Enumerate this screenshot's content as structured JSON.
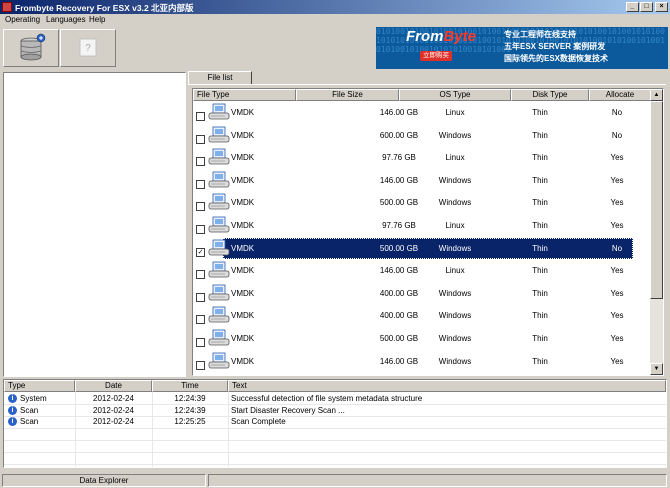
{
  "window": {
    "title": "Frombyte Recovery For ESX v3.2 北亚内部版"
  },
  "window_buttons": {
    "minimize": "_",
    "maximize": "□",
    "close": "×"
  },
  "menu": [
    {
      "label": "Operating"
    },
    {
      "label": "Languages"
    },
    {
      "label": "Help"
    }
  ],
  "toolbar": {
    "help_glyph": "?"
  },
  "banner": {
    "brand_from": "From",
    "brand_byte": "Byte",
    "badge": "立即购买",
    "line1": "专业工程师在线支持",
    "line2": "五年ESX SERVER 案例研发",
    "line3": "国际领先的ESX数据恢复技术",
    "binary": "0101001010010100101001010011010100101001010101001010010101001010101010010010100101001010101001010010101010010101001010010101001010010101010010101001"
  },
  "tabs": [
    {
      "label": "File list"
    }
  ],
  "file_grid": {
    "columns": [
      "File Type",
      "File Size",
      "OS Type",
      "Disk Type",
      "Allocate"
    ],
    "rows": [
      {
        "type": "VMDK",
        "size": "146.00 GB",
        "os": "Linux",
        "disk": "Thin",
        "alloc": "No",
        "checked": false,
        "selected": false
      },
      {
        "type": "VMDK",
        "size": "600.00 GB",
        "os": "Windows",
        "disk": "Thin",
        "alloc": "No",
        "checked": false,
        "selected": false
      },
      {
        "type": "VMDK",
        "size": "97.76 GB",
        "os": "Linux",
        "disk": "Thin",
        "alloc": "Yes",
        "checked": false,
        "selected": false
      },
      {
        "type": "VMDK",
        "size": "146.00 GB",
        "os": "Windows",
        "disk": "Thin",
        "alloc": "Yes",
        "checked": false,
        "selected": false
      },
      {
        "type": "VMDK",
        "size": "500.00 GB",
        "os": "Windows",
        "disk": "Thin",
        "alloc": "Yes",
        "checked": false,
        "selected": false
      },
      {
        "type": "VMDK",
        "size": "97.76 GB",
        "os": "Linux",
        "disk": "Thin",
        "alloc": "Yes",
        "checked": false,
        "selected": false
      },
      {
        "type": "VMDK",
        "size": "500.00 GB",
        "os": "Windows",
        "disk": "Thin",
        "alloc": "No",
        "checked": true,
        "selected": true
      },
      {
        "type": "VMDK",
        "size": "146.00 GB",
        "os": "Linux",
        "disk": "Thin",
        "alloc": "Yes",
        "checked": false,
        "selected": false
      },
      {
        "type": "VMDK",
        "size": "400.00 GB",
        "os": "Windows",
        "disk": "Thin",
        "alloc": "Yes",
        "checked": false,
        "selected": false
      },
      {
        "type": "VMDK",
        "size": "400.00 GB",
        "os": "Windows",
        "disk": "Thin",
        "alloc": "Yes",
        "checked": false,
        "selected": false
      },
      {
        "type": "VMDK",
        "size": "500.00 GB",
        "os": "Windows",
        "disk": "Thin",
        "alloc": "Yes",
        "checked": false,
        "selected": false
      },
      {
        "type": "VMDK",
        "size": "146.00 GB",
        "os": "Windows",
        "disk": "Thin",
        "alloc": "Yes",
        "checked": false,
        "selected": false
      }
    ]
  },
  "log": {
    "columns": [
      "Type",
      "Date",
      "Time",
      "Text"
    ],
    "rows": [
      {
        "type": "System",
        "date": "2012-02-24",
        "time": "12:24:39",
        "text": "Successful detection of file system metadata structure"
      },
      {
        "type": "Scan",
        "date": "2012-02-24",
        "time": "12:24:39",
        "text": "Start Disaster Recovery Scan ..."
      },
      {
        "type": "Scan",
        "date": "2012-02-24",
        "time": "12:25:25",
        "text": "Scan Complete"
      }
    ]
  },
  "statusbar": {
    "panel1": "Data Explorer"
  },
  "colors": {
    "selection": "#0a246a",
    "titlebar_start": "#0a246a",
    "banner": "#0c5a9c"
  },
  "icons": {
    "db": "database-add-icon",
    "help": "help-icon",
    "vm": "virtual-machine-icon",
    "info": "info-icon"
  }
}
